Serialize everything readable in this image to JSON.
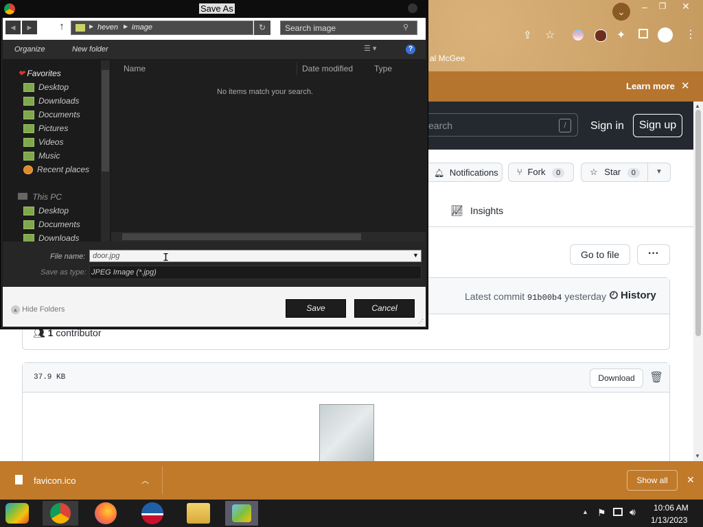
{
  "browser": {
    "bookmark_fragment": "al McGee",
    "banner_learn_more": "Learn more",
    "banner_close": "✕"
  },
  "github": {
    "search_placeholder": "earch",
    "search_shortcut": "/",
    "sign_in": "Sign in",
    "sign_up": "Sign up",
    "notifications": "Notifications",
    "fork": "Fork",
    "fork_count": "0",
    "star": "Star",
    "star_count": "0",
    "insights": "Insights",
    "go_to_file": "Go to file",
    "more": "···",
    "latest_commit_label": "Latest commit",
    "commit_hash": "91b00b4",
    "commit_time": "yesterday",
    "history": "History",
    "contributors_count": "1",
    "contributors_label": "contributor",
    "file_size": "37.9 KB",
    "download": "Download"
  },
  "download_bar": {
    "file": "favicon.ico",
    "show_all": "Show all"
  },
  "taskbar": {
    "time": "10:06 AM",
    "date": "1/13/2023"
  },
  "dialog": {
    "title": "Save As",
    "path": [
      "heven",
      "image"
    ],
    "search_placeholder": "Search image",
    "organize": "Organize",
    "new_folder": "New folder",
    "nav": {
      "favorites": "Favorites",
      "fav_items": [
        "Desktop",
        "Downloads",
        "Documents",
        "Pictures",
        "Videos",
        "Music",
        "Recent places"
      ],
      "this_pc": "This PC",
      "pc_items": [
        "Desktop",
        "Documents",
        "Downloads"
      ]
    },
    "columns": [
      "Name",
      "Date modified",
      "Type"
    ],
    "empty_message": "No items match your search.",
    "file_name_label": "File name:",
    "file_name_value": "door.jpg",
    "save_type_label": "Save as type:",
    "save_type_value": "JPEG Image (*.jpg)",
    "hide_folders": "Hide Folders",
    "save": "Save",
    "cancel": "Cancel"
  }
}
